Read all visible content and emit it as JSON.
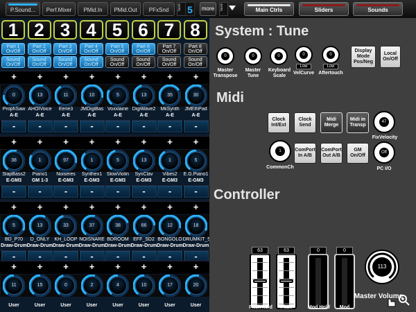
{
  "topbar": {
    "left_tabs": [
      {
        "label": "P.Sound...",
        "active": true
      },
      {
        "label": "Perf.Mixer",
        "active": false
      },
      {
        "label": "PMid.In",
        "active": false
      },
      {
        "label": "PMid.Out",
        "active": false
      },
      {
        "label": "PFxSnd",
        "active": false
      }
    ],
    "bank_label": "bank",
    "bank_number": "5",
    "more_label": "more",
    "right_tabs": [
      {
        "label": "Main Ctrls",
        "active": true
      },
      {
        "label": "Sliders",
        "active": false
      },
      {
        "label": "Sounds",
        "active": false
      }
    ]
  },
  "parts": {
    "numbers": [
      "1",
      "2",
      "3",
      "4",
      "5",
      "6",
      "7",
      "8"
    ],
    "part_buttons": [
      {
        "l1": "Part 1",
        "l2": "On/Off",
        "on": true
      },
      {
        "l1": "Part 2",
        "l2": "On/Off",
        "on": true
      },
      {
        "l1": "Part 3",
        "l2": "On/Off",
        "on": true
      },
      {
        "l1": "Part 4",
        "l2": "On/Off",
        "on": true
      },
      {
        "l1": "Part 5",
        "l2": "On/Off",
        "on": true
      },
      {
        "l1": "Part 6",
        "l2": "On/Off",
        "on": true
      },
      {
        "l1": "Part 7",
        "l2": "On/Off",
        "on": false
      },
      {
        "l1": "Part 8",
        "l2": "On/Off",
        "on": false
      }
    ],
    "sound_buttons": [
      {
        "l1": "Sound",
        "l2": "On/Off",
        "on": true
      },
      {
        "l1": "Sound",
        "l2": "On/Off",
        "on": true
      },
      {
        "l1": "Sound",
        "l2": "On/Off",
        "on": true
      },
      {
        "l1": "Sound",
        "l2": "On/Off",
        "on": true
      },
      {
        "l1": "Sound",
        "l2": "On/Off",
        "on": false
      },
      {
        "l1": "Sound",
        "l2": "On/Off",
        "on": false
      },
      {
        "l1": "Sound",
        "l2": "On/Off",
        "on": false
      },
      {
        "l1": "Sound",
        "l2": "On/Off",
        "on": false
      }
    ],
    "plus_label": "+",
    "minus_label": "-",
    "knob_rows": [
      {
        "names": [
          "ProphSaw",
          "AHOIVoice",
          "Eerie3",
          "JMDigiBas",
          "Voxxlaine",
          "DigiWave2",
          "MkSynth",
          "JMEthPad"
        ],
        "values": [
          "0",
          "13",
          "11",
          "10",
          "5",
          "13",
          "35",
          "30"
        ],
        "levels": [
          0.2,
          0.55,
          0.4,
          0.85,
          0.3,
          0.45,
          0.7,
          0.6
        ],
        "subs": [
          "A-E",
          "A-E",
          "A-E",
          "A-E",
          "A-E",
          "A-E",
          "A-E",
          "A-E"
        ]
      },
      {
        "names": [
          "SlapBass2",
          "Piano1",
          "Noiseres",
          "Synthex1",
          "SlowViolin",
          "SynClav",
          "Vibes2",
          "E.G.Piano1"
        ],
        "values": [
          "38",
          "1",
          "97",
          "1",
          "5",
          "13",
          "1",
          "5"
        ],
        "levels": [
          0.55,
          0.3,
          0.85,
          0.35,
          0.45,
          0.5,
          0.4,
          0.5
        ],
        "subs": [
          "E-GM3",
          "GM 1-3",
          "E-GM3",
          "E-GM3",
          "E-GM3",
          "E-GM3",
          "E-GM3",
          "E-GM3"
        ]
      },
      {
        "names": [
          "BD_P70",
          "D_ONLY",
          "KH_LOOP",
          "NOISNARE",
          "BDROOM",
          "EFF_SD2",
          "BONGOLO",
          "DRUMKIT_5"
        ],
        "values": [
          "5",
          "13",
          "33",
          "37",
          "38",
          "66",
          "12",
          "18"
        ],
        "levels": [
          0.9,
          0.6,
          0.45,
          0.55,
          0.75,
          0.8,
          0.85,
          0.9
        ],
        "subs": [
          "Draw-Drum",
          "Draw-Drum",
          "Draw-Drum",
          "Draw-Drum",
          "Draw-Drum",
          "Draw-Drum",
          "Draw-Drum",
          "Draw-Drum"
        ]
      },
      {
        "names": [
          "",
          "",
          "",
          "",
          "",
          "",
          "",
          ""
        ],
        "values": [
          "11",
          "15",
          "0",
          "2",
          "4",
          "10",
          "17",
          "20"
        ],
        "levels": [
          0.5,
          0.5,
          0.45,
          0.55,
          0.5,
          0.5,
          0.5,
          0.55
        ],
        "subs": [
          "User",
          "User",
          "User",
          "User",
          "User",
          "User",
          "User",
          "User"
        ]
      }
    ]
  },
  "system": {
    "title": "System : Tune",
    "knobs": [
      {
        "value": "0",
        "label": "Master Transpose"
      },
      {
        "value": "0",
        "label": "Master Tune"
      },
      {
        "value": "0",
        "label": "Keyboard Scale"
      },
      {
        "value": "0",
        "label": "VelCurve",
        "box": "Low"
      },
      {
        "value": "0",
        "label": "Aftertouch",
        "box": "Low"
      }
    ],
    "buttons": [
      {
        "label": "Display Mode Pos/Neg"
      },
      {
        "label": "Local On/Off"
      }
    ]
  },
  "midi": {
    "title": "Midi",
    "row1": [
      {
        "label": "Clock Int/Ext",
        "dark": false
      },
      {
        "label": "Clock Send",
        "dark": false
      },
      {
        "label": "Midi Merge",
        "dark": true
      },
      {
        "label": "Midi in Transp",
        "dark": true
      }
    ],
    "fixvelocity": {
      "value": "47",
      "label": "FixVelocity"
    },
    "commonch": {
      "value": "1",
      "label": "CommonCh"
    },
    "row2": [
      {
        "label": "ComPort In A/B",
        "dark": false
      },
      {
        "label": "ComPort Out A/B",
        "dark": false
      },
      {
        "label": "GM On/Off",
        "dark": false
      }
    ],
    "pcio": {
      "value": "Off",
      "label": "PC I/O"
    }
  },
  "controller": {
    "title": "Controller",
    "faders": [
      {
        "label": "Pitch hold",
        "value": "63",
        "level": 0.5
      },
      {
        "label": "Pitch",
        "value": "63",
        "level": 0.5
      }
    ],
    "mods": [
      {
        "label": "Mod Hold",
        "value": "0"
      },
      {
        "label": "Mod",
        "value": "0"
      }
    ],
    "master": {
      "label": "Master Volume",
      "value": "113"
    }
  },
  "colors": {
    "accent": "#2bb3ff",
    "number_border": "#c6cf42",
    "panel_left": "#0b1b2c",
    "panel_right": "#3f3f3f"
  }
}
